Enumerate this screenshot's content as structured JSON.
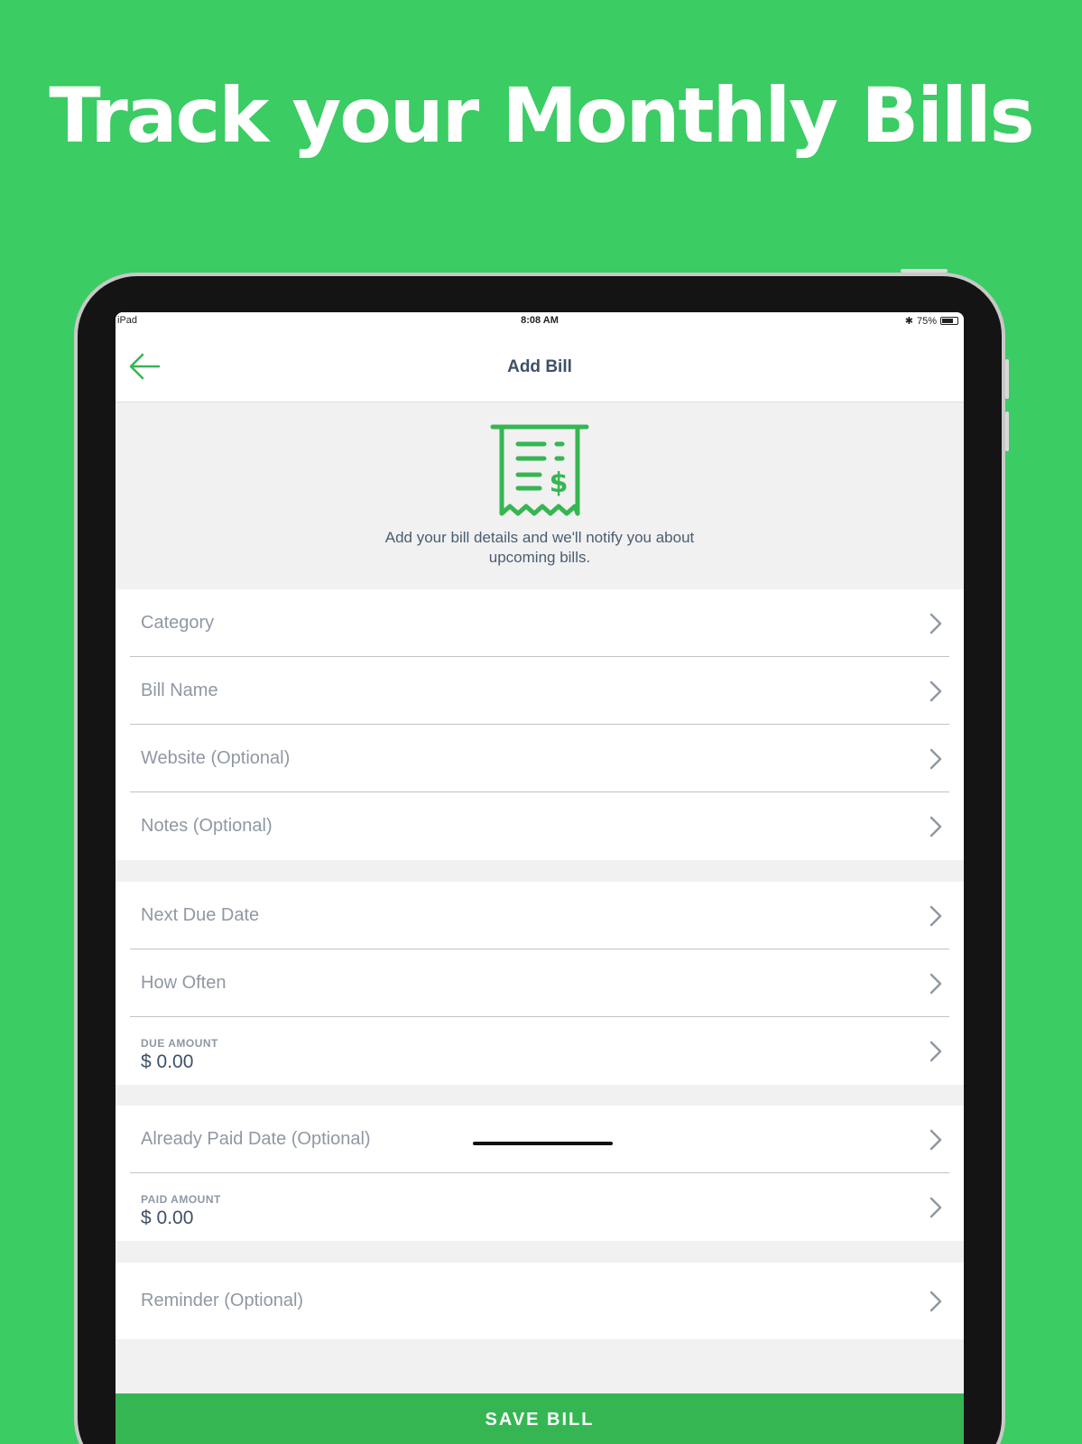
{
  "headline": "Track your Monthly Bills",
  "status_bar": {
    "device": "iPad",
    "time": "8:08 AM",
    "battery": "75%",
    "battery_level": 0.75
  },
  "nav": {
    "title": "Add Bill",
    "back_icon": "arrow-left-icon"
  },
  "hero": {
    "icon": "receipt-dollar-icon",
    "description": "Add your bill details and we'll notify you about upcoming bills."
  },
  "sections": [
    {
      "rows": [
        {
          "label": "Category"
        },
        {
          "label": "Bill Name"
        },
        {
          "label": "Website (Optional)"
        },
        {
          "label": "Notes (Optional)"
        }
      ]
    },
    {
      "rows": [
        {
          "label": "Next Due Date"
        },
        {
          "label": "How Often"
        },
        {
          "caption": "DUE AMOUNT",
          "value": "$ 0.00"
        }
      ]
    },
    {
      "rows": [
        {
          "label": "Already Paid Date (Optional)"
        },
        {
          "caption": "PAID AMOUNT",
          "value": "$ 0.00"
        }
      ]
    },
    {
      "rows": [
        {
          "label": "Reminder (Optional)"
        }
      ]
    }
  ],
  "save_button": "SAVE BILL",
  "colors": {
    "background": "#3bcc64",
    "accent": "#35b653",
    "text_dark": "#3e5068",
    "text_muted": "#8f98a3"
  }
}
